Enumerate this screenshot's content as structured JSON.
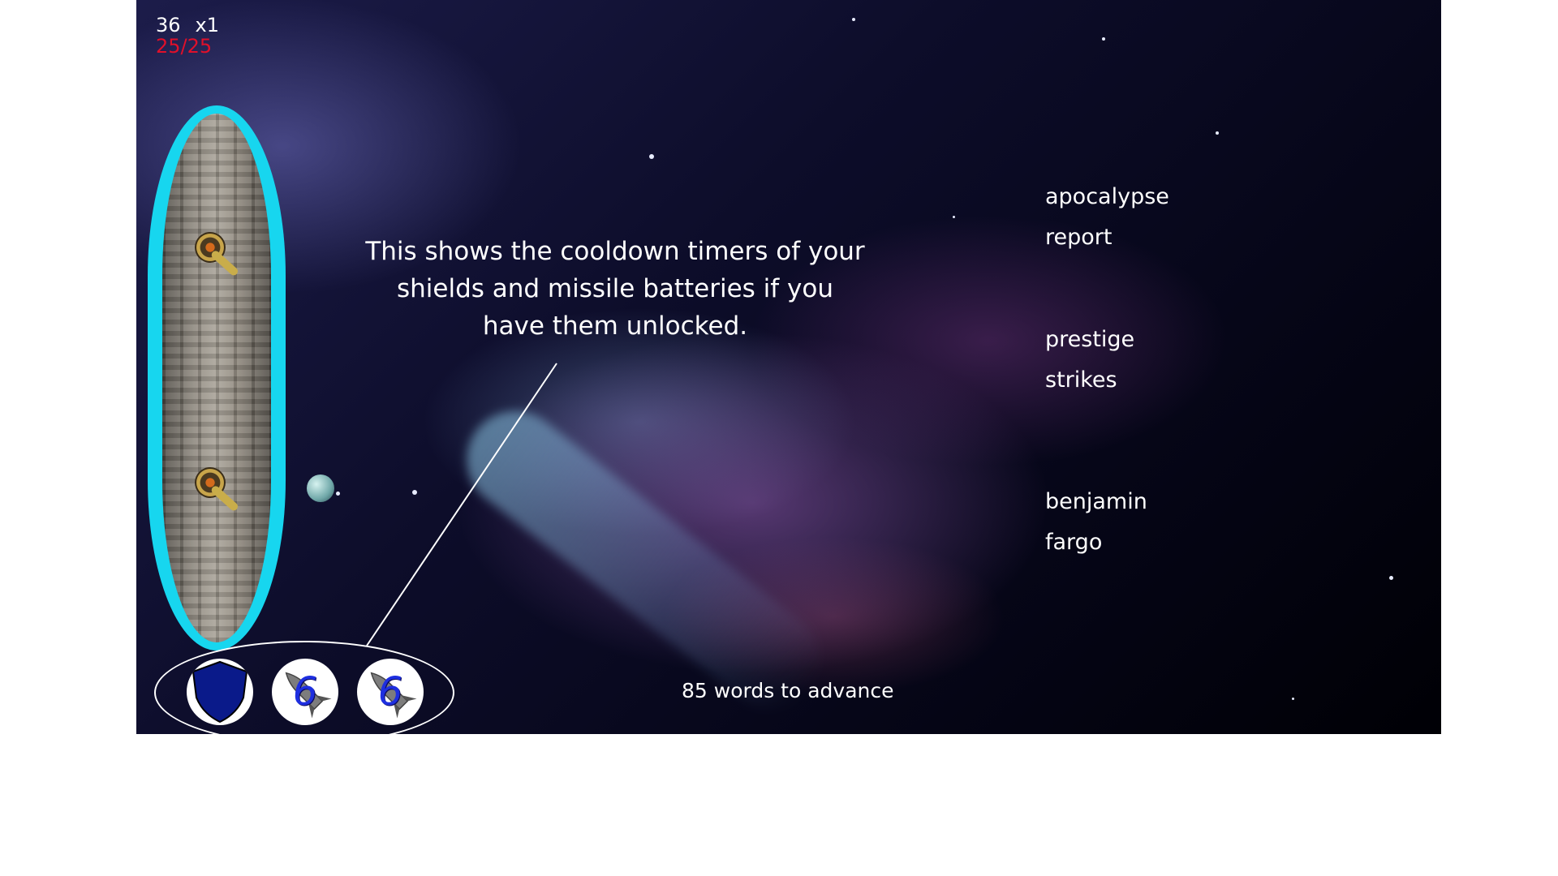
{
  "hud": {
    "score": "36",
    "multiplier": "x1",
    "health": "25/25"
  },
  "tutorial": {
    "line1": "This shows the cooldown timers of your",
    "line2": "shields and missile batteries if you",
    "line3": "have them unlocked."
  },
  "words": [
    {
      "text": "apocalypse"
    },
    {
      "text": "report"
    },
    {
      "text": "prestige"
    },
    {
      "text": "strikes"
    },
    {
      "text": "benjamin"
    },
    {
      "text": "fargo"
    }
  ],
  "cooldowns": [
    {
      "icon": "shield-icon",
      "value": ""
    },
    {
      "icon": "missile-icon",
      "value": "6"
    },
    {
      "icon": "missile-icon",
      "value": "6"
    }
  ],
  "progress": {
    "text": "85 words to advance"
  },
  "colors": {
    "shield_glow": "#17d6ef",
    "health_text": "#e0102a",
    "cooldown_number": "#1e2fe0",
    "shield_fill": "#0a1a8a"
  }
}
